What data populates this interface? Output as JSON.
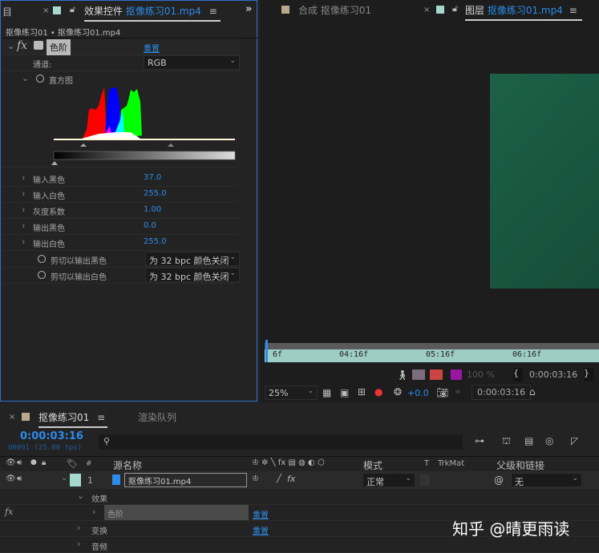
{
  "effects_panel": {
    "menu_icon_label": "目",
    "tab_title": "效果控件",
    "tab_file": "抠像练习01.mp4",
    "breadcrumb": "抠像练习01 • 抠像练习01.mp4",
    "effect_name": "色阶",
    "reset": "重置",
    "channel_label": "通道:",
    "channel_value": "RGB",
    "histogram_label": "直方图",
    "properties": [
      {
        "label": "输入黑色",
        "value": "37.0"
      },
      {
        "label": "输入白色",
        "value": "255.0"
      },
      {
        "label": "灰度系数",
        "value": "1.00"
      },
      {
        "label": "输出黑色",
        "value": "0.0"
      },
      {
        "label": "输出白色",
        "value": "255.0"
      }
    ],
    "clip_options": [
      {
        "label": "剪切以输出黑色",
        "value": "为 32 bpc 颜色关闭"
      },
      {
        "label": "剪切以输出白色",
        "value": "为 32 bpc 颜色关闭"
      }
    ]
  },
  "viewer": {
    "comp_tab": "合成 抠像练习01",
    "layer_tab_title": "图层",
    "layer_tab_file": "抠像练习01.mp4",
    "ruler_ticks": [
      "6f",
      "04:16f",
      "05:16f",
      "06:16f"
    ],
    "opacity": "100 %",
    "in_time": "0:00:03:16",
    "zoom": "25%",
    "exposure": "+0.0",
    "current_time": "0:00:03:16",
    "layer_color": "#1b5a44"
  },
  "timeline": {
    "comp_tab": "抠像练习01",
    "render_tab": "渲染队列",
    "timecode": "0:00:03:16",
    "frame_info": "00091 (25.00 fps)",
    "search_placeholder": "",
    "columns": {
      "number": "#",
      "source": "源名称",
      "mode": "模式",
      "t": "T",
      "trkmat": "TrkMat",
      "parent": "父级和链接"
    },
    "layer": {
      "number": "1",
      "name": "抠像练习01.mp4",
      "mode": "正常",
      "parent": "无"
    },
    "sub_rows": [
      {
        "label": "效果"
      },
      {
        "label": "色阶",
        "reset": "重置"
      },
      {
        "label": "变换",
        "reset": "重置"
      },
      {
        "label": "音频"
      }
    ],
    "fx_label": "fx"
  },
  "watermark": "知乎 @晴更雨读"
}
